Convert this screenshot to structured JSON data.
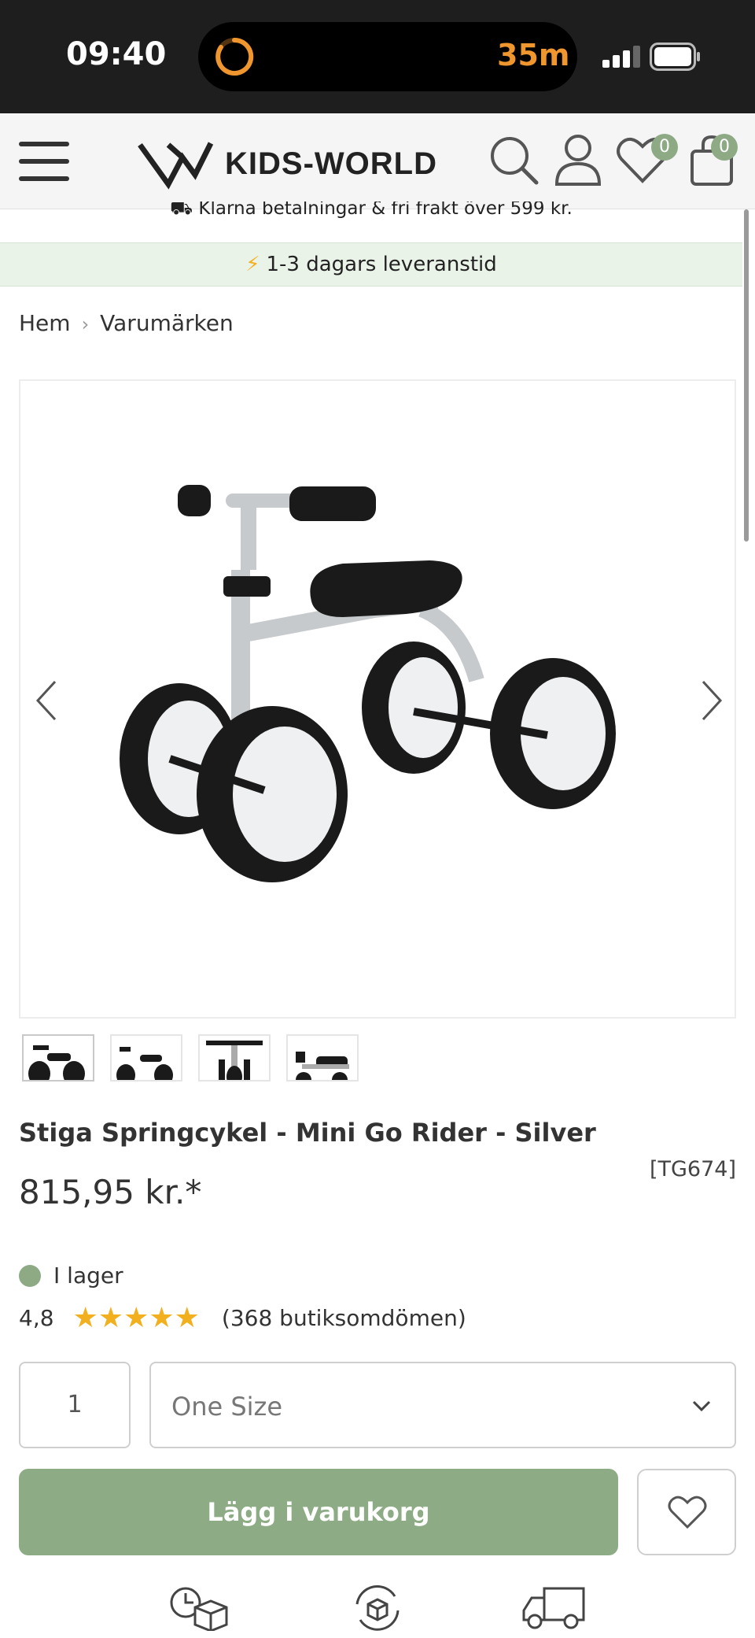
{
  "status_bar": {
    "time": "09:40",
    "activity_text": "35m"
  },
  "header": {
    "logo_text": "KIDS-WORLD",
    "wishlist_count": "0",
    "cart_count": "0"
  },
  "banners": {
    "klarna": "Klarna betalningar & fri frakt över 599 kr.",
    "delivery": "1-3 dagars leveranstid"
  },
  "breadcrumb": {
    "items": [
      "Hem",
      "Varumärken"
    ]
  },
  "product": {
    "title": "Stiga Springcykel - Mini Go Rider - Silver",
    "sku": "[TG674]",
    "price": "815,95 kr.*",
    "stock": "I lager",
    "rating_value": "4,8",
    "rating_stars": "★★★★★",
    "rating_count": "(368 butiksomdömen)",
    "quantity": "1",
    "size_selected": "One Size",
    "add_to_cart_label": "Lägg i varukorg"
  },
  "colors": {
    "accent_green": "#8dab84",
    "star_yellow": "#f2b01e",
    "timer_orange": "#f0962e"
  },
  "icons": {
    "header": [
      "menu-icon",
      "logo-icon",
      "search-icon",
      "user-icon",
      "heart-icon",
      "bag-icon"
    ],
    "usps": [
      "clock-box-icon",
      "return-box-icon",
      "delivery-truck-icon"
    ]
  }
}
